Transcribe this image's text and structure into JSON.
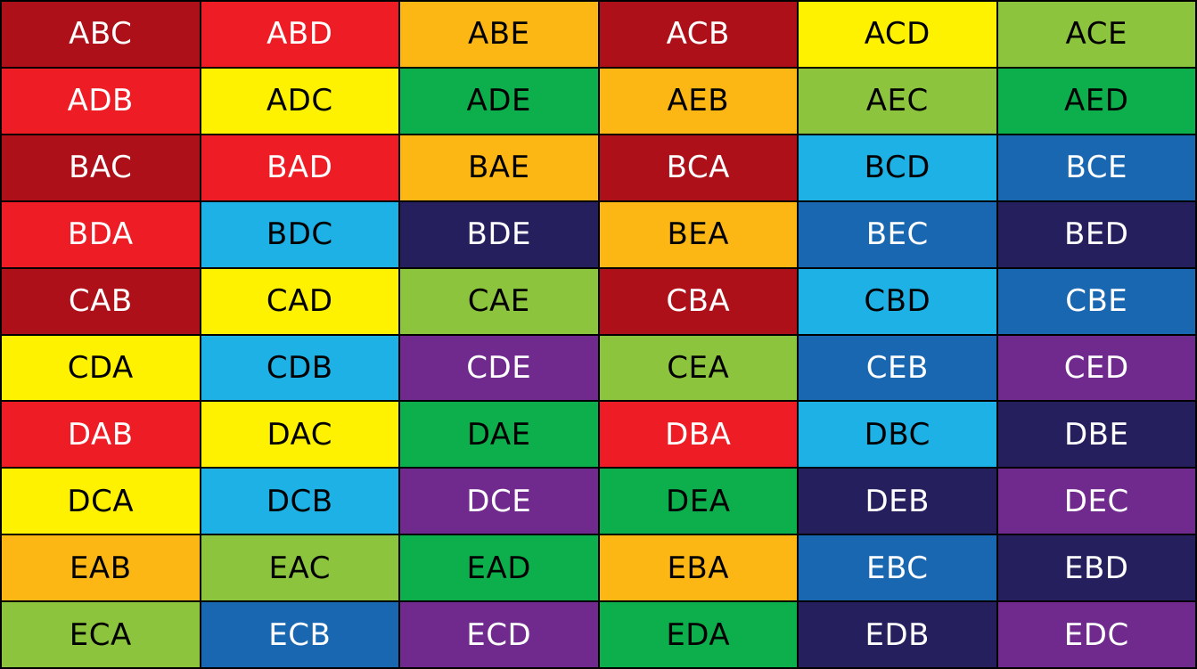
{
  "palette": {
    "darkred": "#AD1018",
    "red": "#EE1C25",
    "orange": "#FDB714",
    "yellow": "#FFF200",
    "lightgreen": "#8CC43E",
    "green": "#0DAF4D",
    "cyan": "#1DB1E6",
    "blue": "#1A67B1",
    "navy": "#25205D",
    "purple": "#702A8E"
  },
  "grid": {
    "rows": [
      [
        {
          "label": "ABC",
          "color": "darkred"
        },
        {
          "label": "ABD",
          "color": "red"
        },
        {
          "label": "ABE",
          "color": "orange"
        },
        {
          "label": "ACB",
          "color": "darkred"
        },
        {
          "label": "ACD",
          "color": "yellow"
        },
        {
          "label": "ACE",
          "color": "lightgreen"
        }
      ],
      [
        {
          "label": "ADB",
          "color": "red"
        },
        {
          "label": "ADC",
          "color": "yellow"
        },
        {
          "label": "ADE",
          "color": "green"
        },
        {
          "label": "AEB",
          "color": "orange"
        },
        {
          "label": "AEC",
          "color": "lightgreen"
        },
        {
          "label": "AED",
          "color": "green"
        }
      ],
      [
        {
          "label": "BAC",
          "color": "darkred"
        },
        {
          "label": "BAD",
          "color": "red"
        },
        {
          "label": "BAE",
          "color": "orange"
        },
        {
          "label": "BCA",
          "color": "darkred"
        },
        {
          "label": "BCD",
          "color": "cyan"
        },
        {
          "label": "BCE",
          "color": "blue"
        }
      ],
      [
        {
          "label": "BDA",
          "color": "red"
        },
        {
          "label": "BDC",
          "color": "cyan"
        },
        {
          "label": "BDE",
          "color": "navy"
        },
        {
          "label": "BEA",
          "color": "orange"
        },
        {
          "label": "BEC",
          "color": "blue"
        },
        {
          "label": "BED",
          "color": "navy"
        }
      ],
      [
        {
          "label": "CAB",
          "color": "darkred"
        },
        {
          "label": "CAD",
          "color": "yellow"
        },
        {
          "label": "CAE",
          "color": "lightgreen"
        },
        {
          "label": "CBA",
          "color": "darkred"
        },
        {
          "label": "CBD",
          "color": "cyan"
        },
        {
          "label": "CBE",
          "color": "blue"
        }
      ],
      [
        {
          "label": "CDA",
          "color": "yellow"
        },
        {
          "label": "CDB",
          "color": "cyan"
        },
        {
          "label": "CDE",
          "color": "purple"
        },
        {
          "label": "CEA",
          "color": "lightgreen"
        },
        {
          "label": "CEB",
          "color": "blue"
        },
        {
          "label": "CED",
          "color": "purple"
        }
      ],
      [
        {
          "label": "DAB",
          "color": "red"
        },
        {
          "label": "DAC",
          "color": "yellow"
        },
        {
          "label": "DAE",
          "color": "green"
        },
        {
          "label": "DBA",
          "color": "red"
        },
        {
          "label": "DBC",
          "color": "cyan"
        },
        {
          "label": "DBE",
          "color": "navy"
        }
      ],
      [
        {
          "label": "DCA",
          "color": "yellow"
        },
        {
          "label": "DCB",
          "color": "cyan"
        },
        {
          "label": "DCE",
          "color": "purple"
        },
        {
          "label": "DEA",
          "color": "green"
        },
        {
          "label": "DEB",
          "color": "navy"
        },
        {
          "label": "DEC",
          "color": "purple"
        }
      ],
      [
        {
          "label": "EAB",
          "color": "orange"
        },
        {
          "label": "EAC",
          "color": "lightgreen"
        },
        {
          "label": "EAD",
          "color": "green"
        },
        {
          "label": "EBA",
          "color": "orange"
        },
        {
          "label": "EBC",
          "color": "blue"
        },
        {
          "label": "EBD",
          "color": "navy"
        }
      ],
      [
        {
          "label": "ECA",
          "color": "lightgreen"
        },
        {
          "label": "ECB",
          "color": "blue"
        },
        {
          "label": "ECD",
          "color": "purple"
        },
        {
          "label": "EDA",
          "color": "green"
        },
        {
          "label": "EDB",
          "color": "navy"
        },
        {
          "label": "EDC",
          "color": "purple"
        }
      ]
    ]
  }
}
